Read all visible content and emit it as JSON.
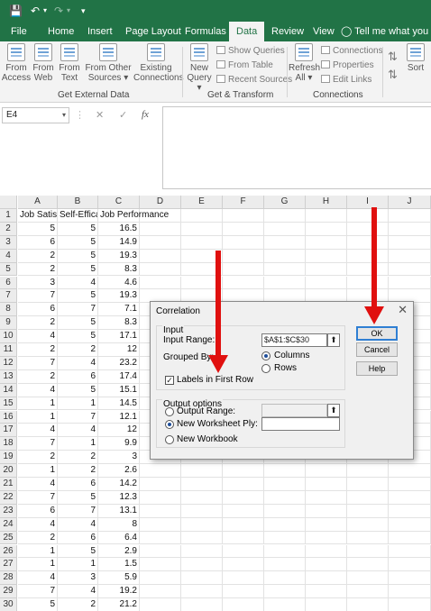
{
  "titlebar": {
    "save_icon": "save-icon",
    "undo_icon": "undo-icon",
    "redo_icon": "redo-icon",
    "qat_icon": "customize-qat-icon"
  },
  "tabs": [
    "File",
    "Home",
    "Insert",
    "Page Layout",
    "Formulas",
    "Data",
    "Review",
    "View"
  ],
  "tell_me": "Tell me what you war",
  "ribbon": {
    "external": {
      "buttons": [
        "From\nAccess",
        "From\nWeb",
        "From\nText",
        "From Other\nSources ▾",
        "Existing\nConnections"
      ],
      "label": "Get External Data"
    },
    "transform": {
      "new_query": "New\nQuery ▾",
      "show_queries": "Show Queries",
      "from_table": "From Table",
      "recent_sources": "Recent Sources",
      "label": "Get & Transform"
    },
    "connections": {
      "refresh": "Refresh\nAll ▾",
      "connections": "Connections",
      "properties": "Properties",
      "edit_links": "Edit Links",
      "label": "Connections"
    },
    "sort": "Sort"
  },
  "formula_bar": {
    "name_box": "E4",
    "cancel": "✕",
    "enter": "✓",
    "fx": "fx",
    "value": ""
  },
  "columns": [
    "A",
    "B",
    "C",
    "D",
    "E",
    "F",
    "G",
    "H",
    "I",
    "J"
  ],
  "rows": [
    [
      "1",
      "Job Satisfaction",
      "Self-Efficacy",
      "Job Performance"
    ],
    [
      "2",
      "5",
      "5",
      "16.5"
    ],
    [
      "3",
      "6",
      "5",
      "14.9"
    ],
    [
      "4",
      "2",
      "5",
      "19.3"
    ],
    [
      "5",
      "2",
      "5",
      "8.3"
    ],
    [
      "6",
      "3",
      "4",
      "4.6"
    ],
    [
      "7",
      "7",
      "5",
      "19.3"
    ],
    [
      "8",
      "6",
      "7",
      "7.1"
    ],
    [
      "9",
      "2",
      "5",
      "8.3"
    ],
    [
      "10",
      "4",
      "5",
      "17.1"
    ],
    [
      "11",
      "2",
      "2",
      "12"
    ],
    [
      "12",
      "7",
      "4",
      "23.2"
    ],
    [
      "13",
      "2",
      "6",
      "17.4"
    ],
    [
      "14",
      "4",
      "5",
      "15.1"
    ],
    [
      "15",
      "1",
      "1",
      "14.5"
    ],
    [
      "16",
      "1",
      "7",
      "12.1"
    ],
    [
      "17",
      "4",
      "4",
      "12"
    ],
    [
      "18",
      "7",
      "1",
      "9.9"
    ],
    [
      "19",
      "2",
      "2",
      "3"
    ],
    [
      "20",
      "1",
      "2",
      "2.6"
    ],
    [
      "21",
      "4",
      "6",
      "14.2"
    ],
    [
      "22",
      "7",
      "5",
      "12.3"
    ],
    [
      "23",
      "6",
      "7",
      "13.1"
    ],
    [
      "24",
      "4",
      "4",
      "8"
    ],
    [
      "25",
      "2",
      "6",
      "6.4"
    ],
    [
      "26",
      "1",
      "5",
      "2.9"
    ],
    [
      "27",
      "1",
      "1",
      "1.5"
    ],
    [
      "28",
      "4",
      "3",
      "5.9"
    ],
    [
      "29",
      "7",
      "4",
      "19.2"
    ],
    [
      "30",
      "5",
      "2",
      "21.2"
    ]
  ],
  "dialog": {
    "title": "Correlation",
    "close": "✕",
    "input_legend": "Input",
    "input_range_label": "Input Range:",
    "input_range_value": "$A$1:$C$30",
    "grouped_by_label": "Grouped By:",
    "columns_label": "Columns",
    "rows_label": "Rows",
    "labels_first_row": "Labels in First Row",
    "output_legend": "Output options",
    "output_range_label": "Output Range:",
    "new_ws_label": "New Worksheet Ply:",
    "new_wb_label": "New Workbook",
    "ok": "OK",
    "cancel": "Cancel",
    "help": "Help",
    "checkmark": "✓"
  },
  "colors": {
    "excel_green": "#217346",
    "arrow": "#e0100f",
    "ok_border": "#2f7fd3"
  }
}
